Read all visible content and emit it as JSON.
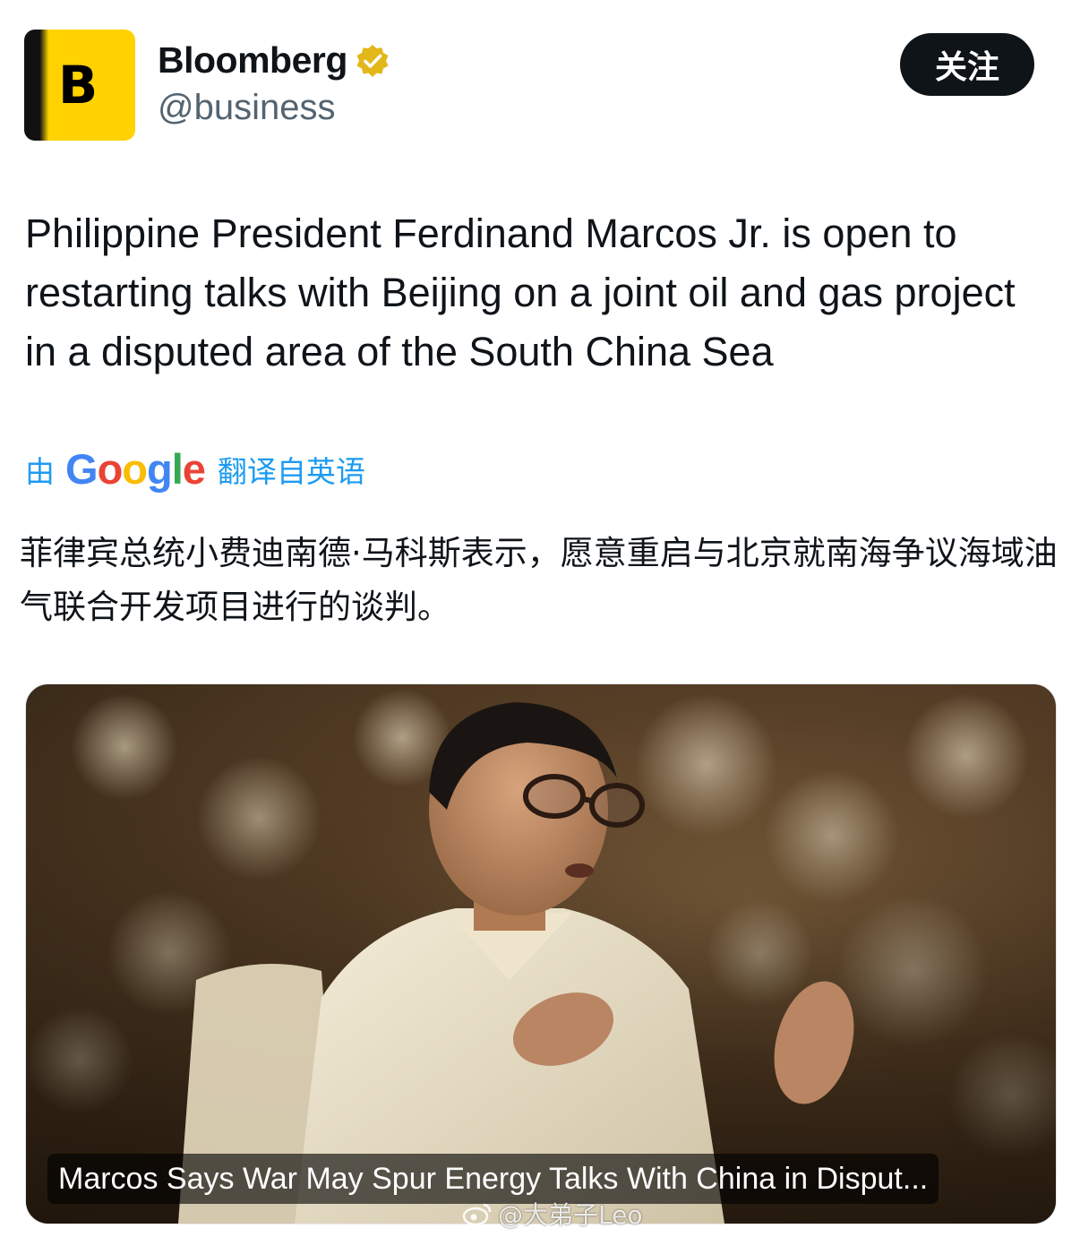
{
  "account": {
    "display_name": "Bloomberg",
    "handle": "@business",
    "avatar_letter": "B",
    "verified_icon": "verified-gold-badge",
    "follow_label": "关注"
  },
  "tweet": {
    "text": "Philippine President Ferdinand Marcos Jr. is open to restarting talks with Beijing on a joint oil and gas project in a disputed area of the South China Sea"
  },
  "translation": {
    "prefix": "由",
    "provider": "Google",
    "suffix": "翻译自英语",
    "text": "菲律宾总统小费迪南德·马科斯表示，愿意重启与北京就南海争议海域油气联合开发项目进行的谈判。"
  },
  "media": {
    "caption": "Marcos Says War May Spur Energy Talks With China in Disput..."
  },
  "watermark": {
    "text": "@大弟子Leo",
    "icon": "weibo-icon"
  },
  "colors": {
    "brand_yellow": "#ffd200",
    "link_blue": "#1d9bf0",
    "verified_gold": "#e2b719",
    "follow_bg": "#0f1419"
  }
}
